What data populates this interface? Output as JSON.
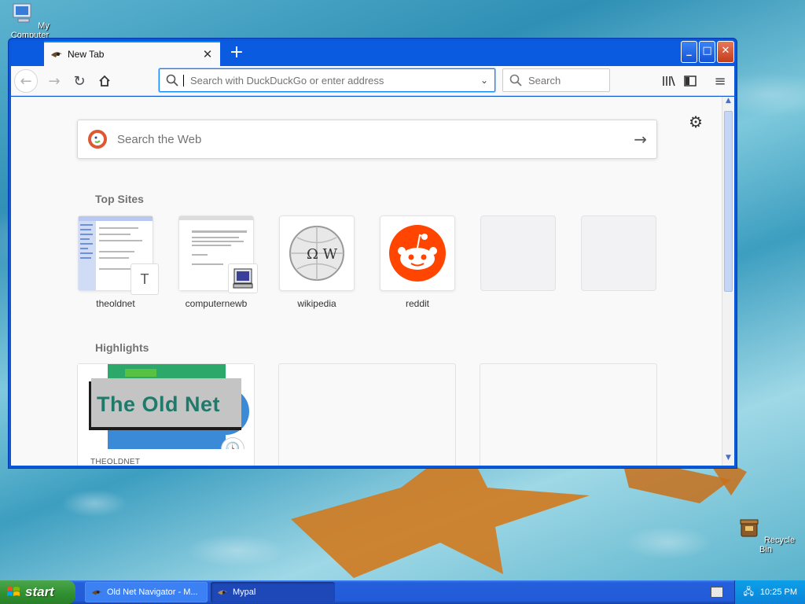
{
  "desktop": {
    "icons": [
      {
        "label": "My Computer"
      },
      {
        "label": "Recycle Bin"
      }
    ]
  },
  "browser": {
    "tab": {
      "title": "New Tab"
    },
    "toolbar": {
      "url_placeholder": "Search with DuckDuckGo or enter address",
      "search_placeholder": "Search"
    },
    "newtab": {
      "web_search_placeholder": "Search the Web",
      "top_sites_title": "Top Sites",
      "top_sites": [
        {
          "label": "theoldnet"
        },
        {
          "label": "computernewb"
        },
        {
          "label": "wikipedia"
        },
        {
          "label": "reddit"
        }
      ],
      "theoldnet_overlay_letter": "T",
      "highlights_title": "Highlights",
      "highlight_logo_text": "The Old Net",
      "highlight_source": "THEOLDNET"
    }
  },
  "taskbar": {
    "start_label": "start",
    "tasks": [
      {
        "label": "Old Net Navigator - M..."
      },
      {
        "label": "Mypal"
      }
    ],
    "clock": "10:25 PM"
  },
  "colors": {
    "accent": "#0a84ff",
    "reddit": "#ff4500",
    "window_frame": "#0a57d8"
  }
}
